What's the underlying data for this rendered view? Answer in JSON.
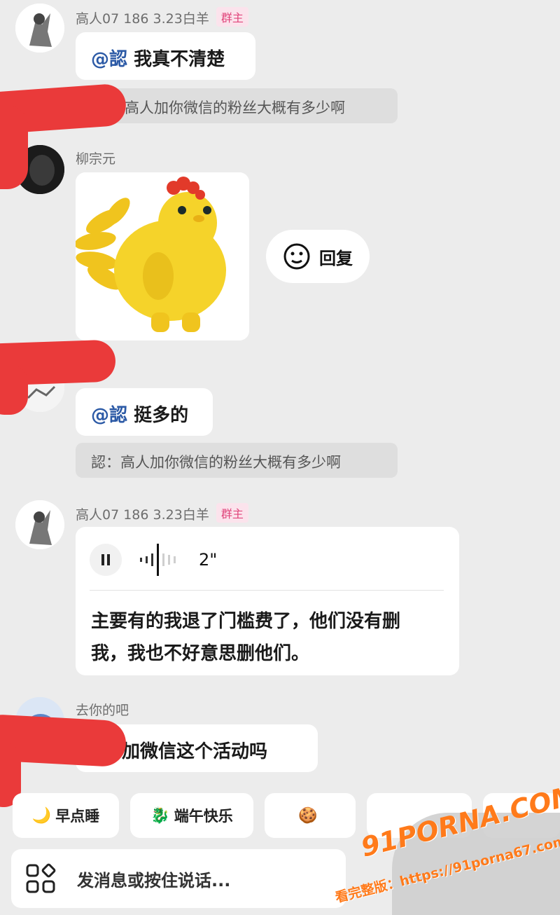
{
  "messages": {
    "m1": {
      "sender": "高人07 186 3.23白羊",
      "badge": "群主",
      "mention": "@認",
      "text": " 我真不清楚"
    },
    "q1": {
      "text": "高人加你微信的粉丝大概有多少啊"
    },
    "m2": {
      "sender": "柳宗元"
    },
    "reply_popup": {
      "label": "回复"
    },
    "m3": {
      "mention": "@認",
      "text": " 挺多的"
    },
    "q2": {
      "text": "認：高人加你微信的粉丝大概有多少啊"
    },
    "m4": {
      "sender": "高人07 186 3.23白羊",
      "badge": "群主",
      "voice_duration": "2\"",
      "transcript": "主要有的我退了门槛费了，他们没有删我，我也不好意思删他们。"
    },
    "m5": {
      "sender": "去你的吧",
      "text": "加微信这个活动吗"
    }
  },
  "quick_chips": [
    {
      "icon": "sleep-icon",
      "label": "早点睡"
    },
    {
      "icon": "dragon-icon",
      "label": "端午快乐"
    },
    {
      "icon": "cookie-icon",
      "label": ""
    },
    {
      "label": ""
    },
    {
      "label": ""
    }
  ],
  "input": {
    "placeholder": "发消息或按住说话..."
  },
  "watermark": {
    "brand": "91PORNA.COM",
    "url": "看完整版：https://91porna67.com"
  },
  "colors": {
    "mention": "#2c5aa6",
    "badge": "#e0457b",
    "redact": "#ea3a3a"
  }
}
